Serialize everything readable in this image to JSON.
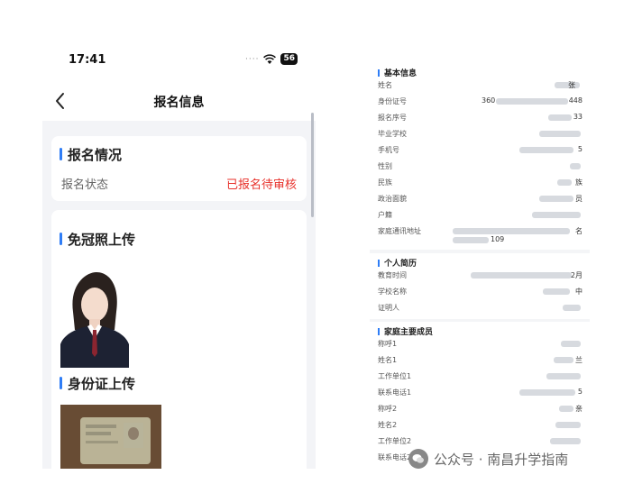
{
  "phone": {
    "status_time": "17:41",
    "signal_dots": "····",
    "battery": "56",
    "nav_title": "报名信息",
    "card_status": {
      "title": "报名情况",
      "label": "报名状态",
      "value": "已报名待审核",
      "value_color": "#e8312b"
    },
    "photo_title": "免冠照上传",
    "id_title": "身份证上传",
    "accent": "#2f7df6"
  },
  "form": {
    "basic": {
      "title": "基本信息",
      "rows": [
        {
          "label": "姓名",
          "value": "张"
        },
        {
          "label": "身份证号",
          "prefix": "360",
          "value": "448"
        },
        {
          "label": "报名序号",
          "value": "33"
        },
        {
          "label": "毕业学校",
          "value": ""
        },
        {
          "label": "手机号",
          "value": "5"
        },
        {
          "label": "性别",
          "value": ""
        },
        {
          "label": "民族",
          "value": "族"
        },
        {
          "label": "政治面貌",
          "value": "员"
        },
        {
          "label": "户籍",
          "value": ""
        },
        {
          "label": "家庭通讯地址",
          "value": "名",
          "value2": "109"
        }
      ]
    },
    "resume": {
      "title": "个人简历",
      "rows": [
        {
          "label": "教育时间",
          "value": "2月"
        },
        {
          "label": "学校名称",
          "value": "中"
        },
        {
          "label": "证明人",
          "value": ""
        }
      ]
    },
    "family": {
      "title": "家庭主要成员",
      "rows": [
        {
          "label": "称呼1",
          "value": ""
        },
        {
          "label": "姓名1",
          "value": "兰"
        },
        {
          "label": "工作单位1",
          "value": ""
        },
        {
          "label": "联系电话1",
          "value": "5"
        },
        {
          "label": "称呼2",
          "value": "亲"
        },
        {
          "label": "姓名2",
          "value": ""
        },
        {
          "label": "工作单位2",
          "value": ""
        },
        {
          "label": "联系电话2",
          "value": ""
        }
      ]
    }
  },
  "watermark": {
    "text": "公众号 · 南昌升学指南"
  }
}
